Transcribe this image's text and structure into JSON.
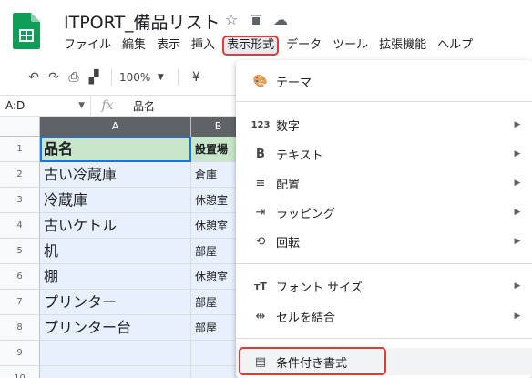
{
  "doc": {
    "title": "ITPORT_備品リスト"
  },
  "menubar": [
    "ファイル",
    "編集",
    "表示",
    "挿入",
    "表示形式",
    "データ",
    "ツール",
    "拡張機能",
    "ヘルプ"
  ],
  "toolbar": {
    "zoom": "100%",
    "currency": "¥"
  },
  "formula_bar": {
    "name_box": "A:D",
    "fx_label": "fx",
    "value": "品名"
  },
  "grid": {
    "columns": [
      "A",
      "B"
    ],
    "rows": [
      "1",
      "2",
      "3",
      "4",
      "5",
      "6",
      "7",
      "8",
      "9",
      "10"
    ],
    "col_a": [
      "品名",
      "古い冷蔵庫",
      "冷蔵庫",
      "古いケトル",
      "机",
      "棚",
      "プリンター",
      "プリンター台",
      "",
      ""
    ],
    "col_b": [
      "設置場",
      "倉庫",
      "休憩室",
      "休憩室",
      "部屋",
      "休憩室",
      "部屋",
      "部屋",
      "",
      ""
    ]
  },
  "format_menu": {
    "items": [
      {
        "icon": "palette-icon",
        "glyph": "🎨",
        "label": "テーマ",
        "submenu": false
      },
      {
        "icon": "number-format-icon",
        "glyph": "123",
        "label": "数字",
        "submenu": true
      },
      {
        "icon": "bold-icon",
        "glyph": "B",
        "label": "テキスト",
        "submenu": true
      },
      {
        "icon": "align-icon",
        "glyph": "≡",
        "label": "配置",
        "submenu": true
      },
      {
        "icon": "wrap-icon",
        "glyph": "⇥",
        "label": "ラッピング",
        "submenu": true
      },
      {
        "icon": "rotate-icon",
        "glyph": "⟲",
        "label": "回転",
        "submenu": true
      },
      {
        "icon": "font-size-icon",
        "glyph": "тT",
        "label": "フォント サイズ",
        "submenu": true
      },
      {
        "icon": "merge-cells-icon",
        "glyph": "⇹",
        "label": "セルを結合",
        "submenu": true
      },
      {
        "icon": "paint-roller-icon",
        "glyph": "▤",
        "label": "条件付き書式",
        "submenu": false
      }
    ]
  },
  "colors": {
    "accent_red": "#e53935",
    "header_green": "#c8e6c9",
    "selection_blue": "#1a73e8",
    "selected_fill": "#e8f0fe"
  }
}
